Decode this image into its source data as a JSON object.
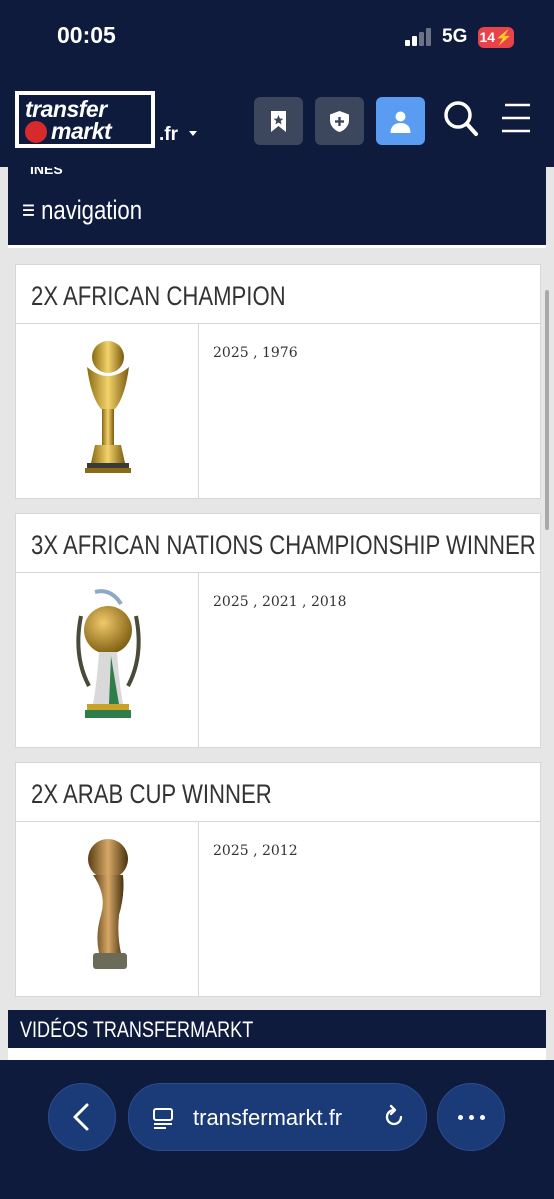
{
  "status_bar": {
    "time": "00:05",
    "network": "5G",
    "battery": "14"
  },
  "header": {
    "logo_line1": "transfer",
    "logo_line2": "markt",
    "domain_suffix": ".fr",
    "icons": [
      "bookmark-star-icon",
      "shield-plus-icon",
      "user-icon",
      "search-icon",
      "menu-icon"
    ]
  },
  "nav": {
    "cut_text": "INES",
    "label": "≡ navigation"
  },
  "titles": [
    {
      "title": "2X AFRICAN CHAMPION",
      "years": "2025 ,  1976",
      "trophy_icon": "africa-cup-trophy-icon"
    },
    {
      "title": "3X AFRICAN NATIONS CHAMPIONSHIP WINNER",
      "years": "2025 ,  2021 ,  2018",
      "trophy_icon": "chan-trophy-icon"
    },
    {
      "title": "2X ARAB CUP WINNER",
      "years": "2025 ,  2012",
      "trophy_icon": "arab-cup-trophy-icon"
    }
  ],
  "videos": {
    "label": "VIDÉOS TRANSFERMARKT"
  },
  "browser": {
    "url": "transfermarkt.fr"
  },
  "colors": {
    "navy": "#0e1b3d",
    "accent_blue": "#5b9cf3",
    "battery_red": "#e8434a",
    "gold": "#c9a227"
  }
}
